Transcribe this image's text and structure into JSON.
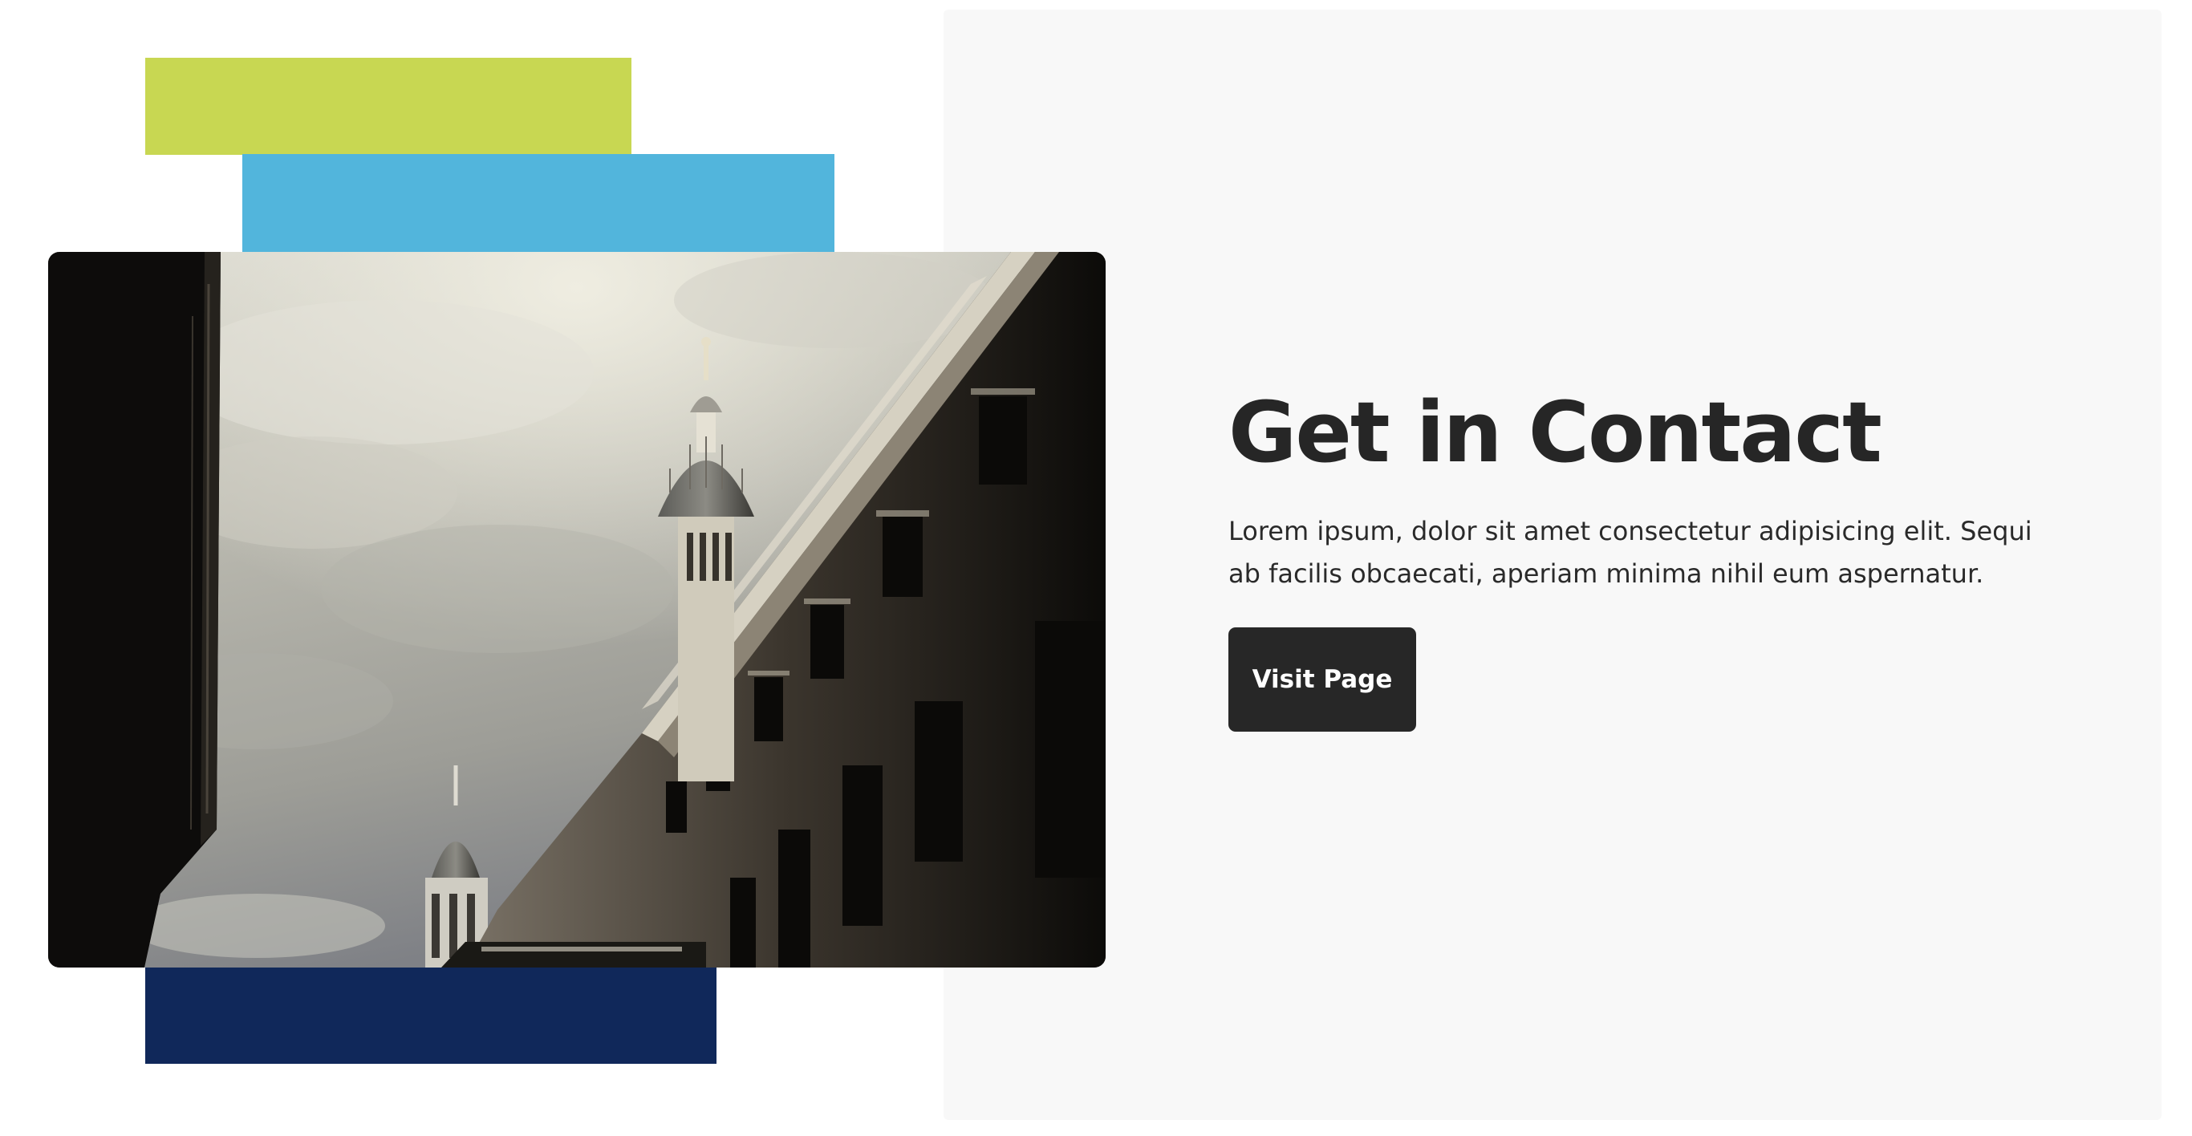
{
  "colors": {
    "accent_lime": "#c8d752",
    "accent_sky": "#52b5dc",
    "accent_navy": "#10285a",
    "panel_bg": "#f8f8f8",
    "heading": "#262626",
    "button_bg": "#272727",
    "button_text": "#ffffff"
  },
  "hero_image": {
    "subject": "photo-building-domes"
  },
  "contact": {
    "title": "Get in Contact",
    "description": "Lorem ipsum, dolor sit amet consectetur adipisicing elit. Sequi ab facilis obcaecati, aperiam minima nihil eum aspernatur.",
    "button_label": "Visit Page"
  }
}
